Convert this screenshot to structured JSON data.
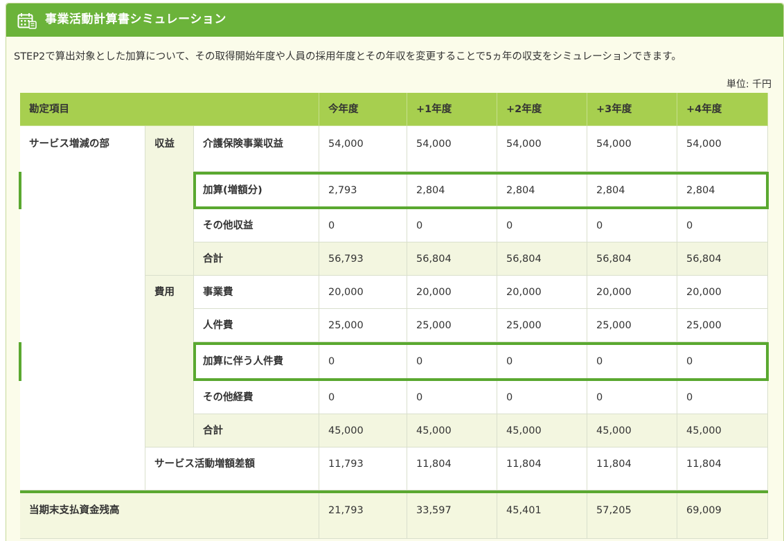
{
  "header": {
    "icon": "calendar-calculator-icon",
    "title": "事業活動計算書シミュレーション"
  },
  "description": "STEP2で算出対象とした加算について、その取得開始年度や人員の採用年度とその年収を変更することで5ヵ年の収支をシミュレーションできます。",
  "unit_label": "単位: 千円",
  "colors": {
    "header_bg": "#6bb33a",
    "table_header_bg": "#a7cf4f",
    "highlight": "#5aa830",
    "sum_row_bg": "#f3f6e0"
  },
  "table": {
    "header": {
      "item": "勘定項目",
      "years": [
        "今年度",
        "+1年度",
        "+2年度",
        "+3年度",
        "+4年度"
      ]
    },
    "section": "サービス増減の部",
    "revenue_group": "収益",
    "expense_group": "費用",
    "rows": {
      "care_revenue": {
        "label": "介護保険事業収益",
        "values": [
          "54,000",
          "54,000",
          "54,000",
          "54,000",
          "54,000"
        ]
      },
      "addition": {
        "label": "加算(増額分)",
        "values": [
          "2,793",
          "2,804",
          "2,804",
          "2,804",
          "2,804"
        ]
      },
      "other_revenue": {
        "label": "その他収益",
        "values": [
          "0",
          "0",
          "0",
          "0",
          "0"
        ]
      },
      "revenue_total": {
        "label": "合計",
        "values": [
          "56,793",
          "56,804",
          "56,804",
          "56,804",
          "56,804"
        ]
      },
      "business_cost": {
        "label": "事業費",
        "values": [
          "20,000",
          "20,000",
          "20,000",
          "20,000",
          "20,000"
        ]
      },
      "personnel_cost": {
        "label": "人件費",
        "values": [
          "25,000",
          "25,000",
          "25,000",
          "25,000",
          "25,000"
        ]
      },
      "addition_personnel": {
        "label": "加算に伴う人件費",
        "values": [
          "0",
          "0",
          "0",
          "0",
          "0"
        ]
      },
      "other_cost": {
        "label": "その他経費",
        "values": [
          "0",
          "0",
          "0",
          "0",
          "0"
        ]
      },
      "expense_total": {
        "label": "合計",
        "values": [
          "45,000",
          "45,000",
          "45,000",
          "45,000",
          "45,000"
        ]
      },
      "service_diff": {
        "label": "サービス活動増額差額",
        "values": [
          "11,793",
          "11,804",
          "11,804",
          "11,804",
          "11,804"
        ]
      },
      "period_end_balance": {
        "label": "当期末支払資金残高",
        "values": [
          "21,793",
          "33,597",
          "45,401",
          "57,205",
          "69,009"
        ]
      }
    }
  }
}
